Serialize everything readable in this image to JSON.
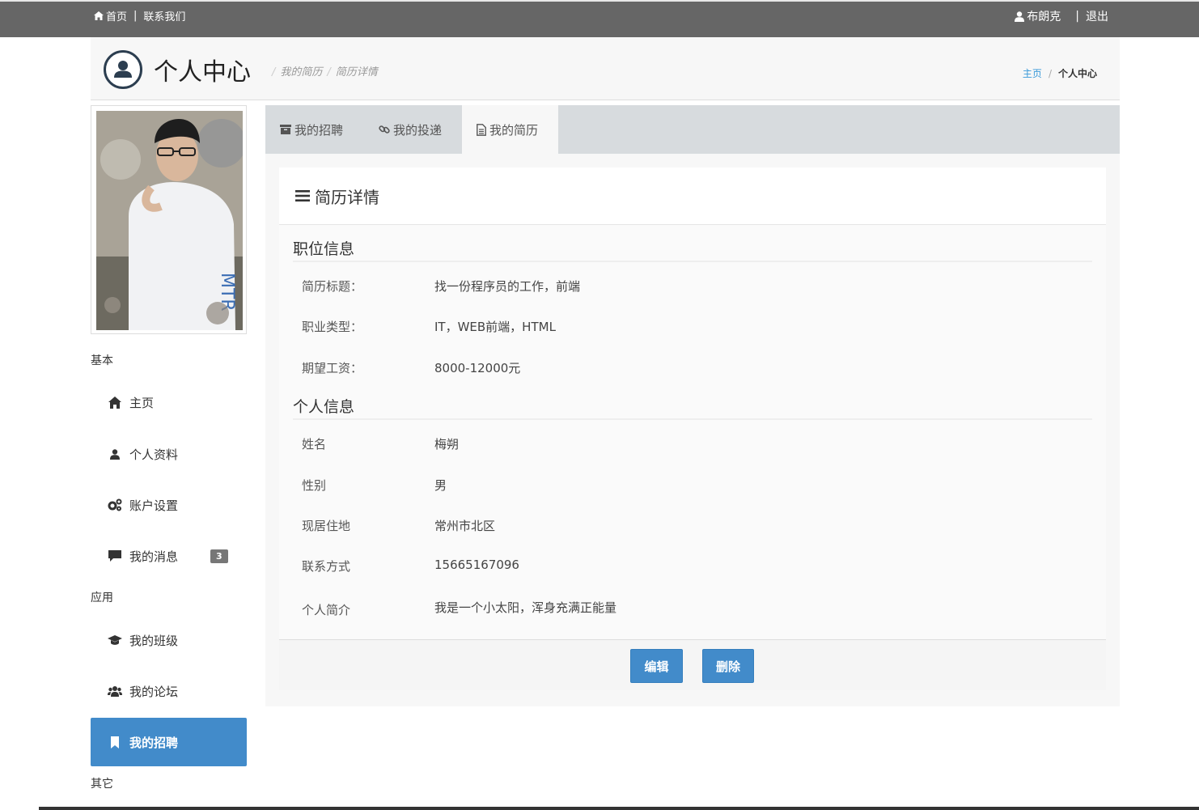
{
  "topbar": {
    "home_label": "首页",
    "contact_label": "联系我们",
    "user_name": "布朗克",
    "logout_label": "退出"
  },
  "header": {
    "title": "个人中心",
    "sub_1": "我的简历",
    "sub_2": "简历详情",
    "crumb_home": "主页",
    "crumb_current": "个人中心"
  },
  "sidebar": {
    "group_basic": "基本",
    "group_apps": "应用",
    "group_other": "其它",
    "items": [
      {
        "label": "主页",
        "icon": "home-icon"
      },
      {
        "label": "个人资料",
        "icon": "user-icon"
      },
      {
        "label": "账户设置",
        "icon": "gears-icon"
      },
      {
        "label": "我的消息",
        "icon": "comment-icon",
        "badge": "3"
      },
      {
        "label": "我的班级",
        "icon": "graduation-cap-icon"
      },
      {
        "label": "我的论坛",
        "icon": "users-icon"
      },
      {
        "label": "我的招聘",
        "icon": "bookmark-icon",
        "active": true
      }
    ]
  },
  "tabs": [
    {
      "label": "我的招聘",
      "icon": "archive-icon"
    },
    {
      "label": "我的投递",
      "icon": "link-icon"
    },
    {
      "label": "我的简历",
      "icon": "file-icon",
      "active": true
    }
  ],
  "card": {
    "title": "简历详情",
    "job_section": "职位信息",
    "job_rows": [
      {
        "label": "简历标题：",
        "value": "找一份程序员的工作，前端"
      },
      {
        "label": "职业类型：",
        "value": "IT，WEB前端，HTML"
      },
      {
        "label": "期望工资：",
        "value": "8000-12000元"
      }
    ],
    "personal_section": "个人信息",
    "personal_rows": [
      {
        "label": "姓名",
        "value": "梅朔"
      },
      {
        "label": "性别",
        "value": "男"
      },
      {
        "label": "现居住地",
        "value": "常州市北区"
      },
      {
        "label": "联系方式",
        "value": "15665167096"
      },
      {
        "label": "个人简介",
        "value": "我是一个小太阳，浑身充满正能量"
      }
    ],
    "edit_label": "编辑",
    "delete_label": "删除"
  },
  "colors": {
    "topbar": "#666666",
    "accent": "#428bca",
    "tabs_bg": "#d7dbde"
  }
}
